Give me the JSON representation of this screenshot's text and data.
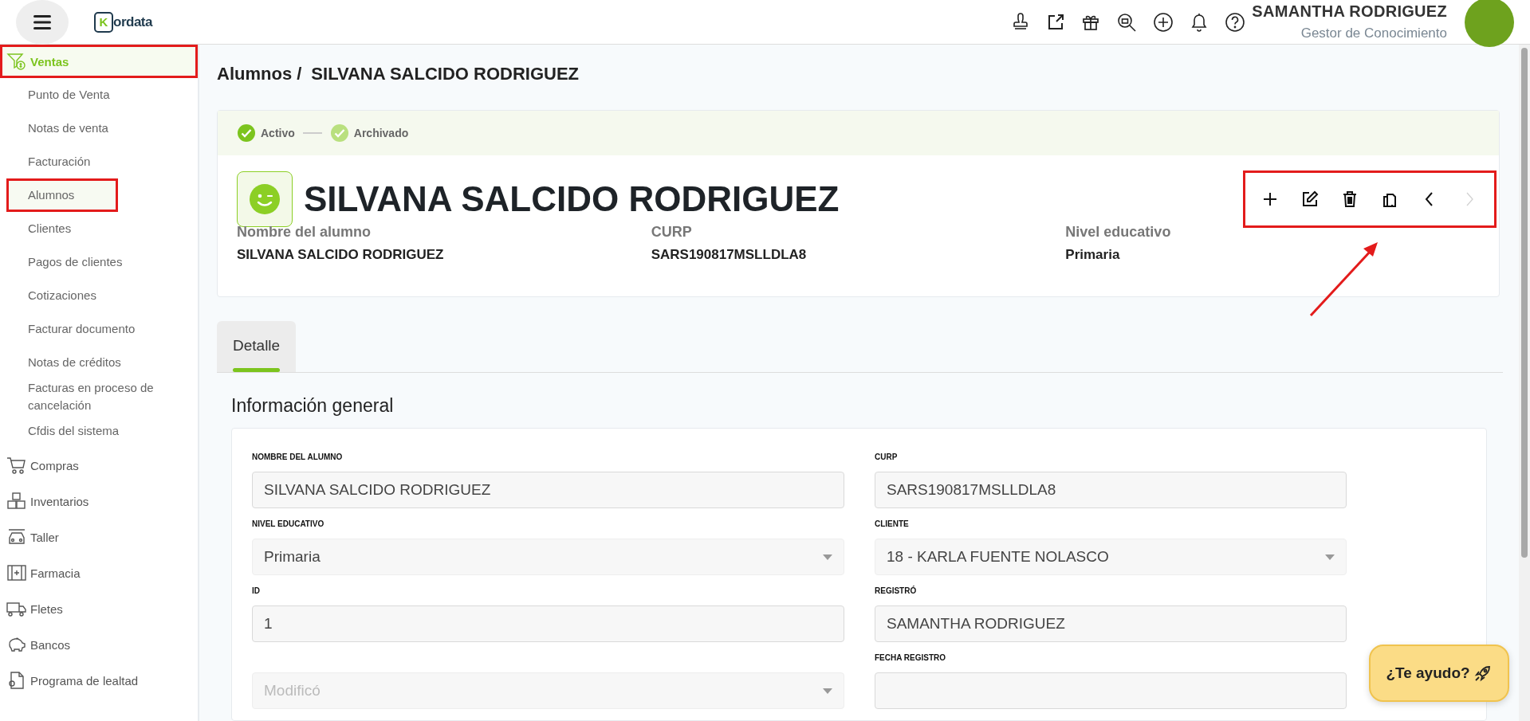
{
  "header": {
    "logo_mark": "K",
    "logo_text": "ordata",
    "user_name": "SAMANTHA RODRIGUEZ",
    "user_role": "Gestor de Conocimiento"
  },
  "sidebar": {
    "sections": [
      {
        "label": "Ventas",
        "active": true,
        "highlighted": true,
        "children": [
          {
            "label": "Punto de Venta",
            "selected": false,
            "highlighted": false
          },
          {
            "label": "Notas de venta",
            "selected": false,
            "highlighted": false
          },
          {
            "label": "Facturación",
            "selected": false,
            "highlighted": false
          },
          {
            "label": "Alumnos",
            "selected": true,
            "highlighted": true
          },
          {
            "label": "Clientes",
            "selected": false,
            "highlighted": false
          },
          {
            "label": "Pagos de clientes",
            "selected": false,
            "highlighted": false
          },
          {
            "label": "Cotizaciones",
            "selected": false,
            "highlighted": false
          },
          {
            "label": "Facturar documento",
            "selected": false,
            "highlighted": false
          },
          {
            "label": "Notas de créditos",
            "selected": false,
            "highlighted": false
          },
          {
            "label": "Facturas en proceso de cancelación",
            "selected": false,
            "highlighted": false
          },
          {
            "label": "Cfdis del sistema",
            "selected": false,
            "highlighted": false
          }
        ]
      },
      {
        "label": "Compras",
        "active": false,
        "highlighted": false
      },
      {
        "label": "Inventarios",
        "active": false,
        "highlighted": false
      },
      {
        "label": "Taller",
        "active": false,
        "highlighted": false
      },
      {
        "label": "Farmacia",
        "active": false,
        "highlighted": false
      },
      {
        "label": "Fletes",
        "active": false,
        "highlighted": false
      },
      {
        "label": "Bancos",
        "active": false,
        "highlighted": false
      },
      {
        "label": "Programa de lealtad",
        "active": false,
        "highlighted": false
      }
    ]
  },
  "breadcrumb": {
    "parent": "Alumnos /",
    "current": "SILVANA SALCIDO RODRIGUEZ"
  },
  "record": {
    "steps": [
      {
        "label": "Activo",
        "selected": true
      },
      {
        "label": "Archivado",
        "selected": false
      }
    ],
    "title": "SILVANA SALCIDO RODRIGUEZ",
    "actions_highlighted": true,
    "actions": [
      {
        "disabled": false
      },
      {
        "disabled": false
      },
      {
        "disabled": false
      },
      {
        "disabled": false
      },
      {
        "disabled": false
      },
      {
        "disabled": true
      }
    ],
    "info": [
      {
        "label": "Nombre del alumno",
        "value": "SILVANA SALCIDO RODRIGUEZ"
      },
      {
        "label": "CURP",
        "value": "SARS190817MSLLDLA8"
      },
      {
        "label": "Nivel educativo",
        "value": "Primaria"
      }
    ]
  },
  "tabs": [
    {
      "label": "Detalle",
      "selected": true
    }
  ],
  "section_title": "Información general",
  "fields": [
    {
      "kind": "text",
      "label": "NOMBRE DEL ALUMNO",
      "value": "SILVANA SALCIDO RODRIGUEZ"
    },
    {
      "kind": "text",
      "label": "CURP",
      "value": "SARS190817MSLLDLA8"
    },
    {
      "kind": "select",
      "label": "NIVEL EDUCATIVO",
      "value": "Primaria"
    },
    {
      "kind": "select",
      "label": "CLIENTE",
      "value": "18 - KARLA FUENTE NOLASCO"
    },
    {
      "kind": "text",
      "label": "ID",
      "value": "1"
    },
    {
      "kind": "text",
      "label": "REGISTRÓ",
      "value": "SAMANTHA RODRIGUEZ"
    },
    {
      "kind": "select",
      "placeholder": "Modificó"
    },
    {
      "kind": "text",
      "label": "FECHA REGISTRO"
    }
  ],
  "help_button": "¿Te ayudo?"
}
